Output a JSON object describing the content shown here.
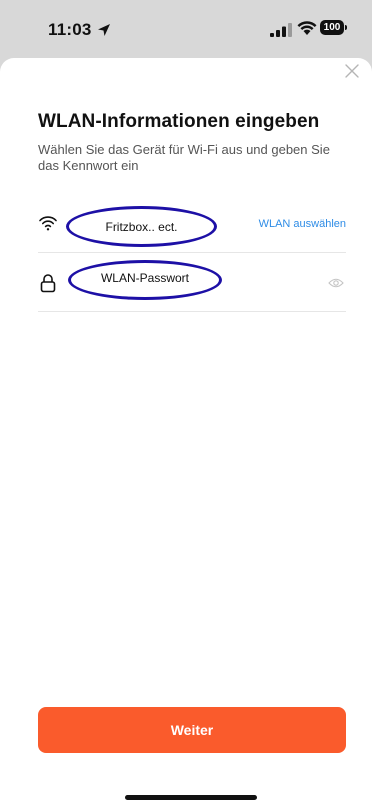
{
  "status_bar": {
    "time": "11:03",
    "battery": "100",
    "icons": [
      "location-arrow-icon",
      "cellular-signal-icon",
      "wifi-icon",
      "battery-icon"
    ]
  },
  "dialog": {
    "title": "WLAN-Informationen eingeben",
    "subtitle": "Wählen Sie das Gerät für Wi-Fi aus und geben Sie das Kennwort ein",
    "wifi_row": {
      "icon": "wifi-icon",
      "value": "Fritzbox.. ect.",
      "select_label": "WLAN auswählen"
    },
    "password_row": {
      "icon": "lock-icon",
      "value": "WLAN-Passwort",
      "toggle_icon": "eye-icon"
    },
    "submit_label": "Weiter"
  },
  "colors": {
    "accent": "#fa5b2c",
    "link": "#2e8ce6",
    "annotation": "#1d10a6"
  }
}
